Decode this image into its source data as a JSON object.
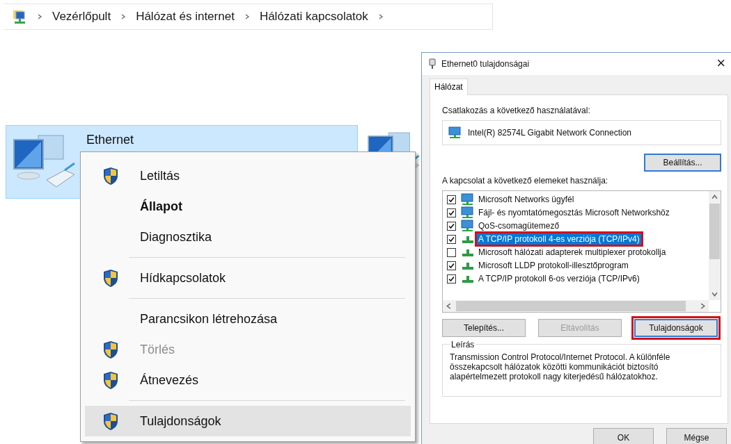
{
  "breadcrumb": {
    "items": [
      "Vezérlőpult",
      "Hálózat és internet",
      "Hálózati kapcsolatok"
    ]
  },
  "connections": [
    {
      "label": "Ethernet",
      "selected": true
    }
  ],
  "context_menu": {
    "items": [
      {
        "kind": "item",
        "label": "Letiltás",
        "shield": true,
        "bold": false,
        "disabled": false,
        "selected": false
      },
      {
        "kind": "item",
        "label": "Állapot",
        "shield": false,
        "bold": true,
        "disabled": false,
        "selected": false
      },
      {
        "kind": "item",
        "label": "Diagnosztika",
        "shield": false,
        "bold": false,
        "disabled": false,
        "selected": false
      },
      {
        "kind": "separator"
      },
      {
        "kind": "item",
        "label": "Hídkapcsolatok",
        "shield": true,
        "bold": false,
        "disabled": false,
        "selected": false
      },
      {
        "kind": "separator"
      },
      {
        "kind": "item",
        "label": "Parancsikon létrehozása",
        "shield": false,
        "bold": false,
        "disabled": false,
        "selected": false
      },
      {
        "kind": "item",
        "label": "Törlés",
        "shield": true,
        "bold": false,
        "disabled": true,
        "selected": false
      },
      {
        "kind": "item",
        "label": "Átnevezés",
        "shield": true,
        "bold": false,
        "disabled": false,
        "selected": false
      },
      {
        "kind": "separator"
      },
      {
        "kind": "item",
        "label": "Tulajdonságok",
        "shield": true,
        "bold": false,
        "disabled": false,
        "selected": true
      }
    ]
  },
  "dialog": {
    "title": "Ethernet0 tulajdonságai",
    "close": "×",
    "tabs": [
      {
        "label": "Hálózat",
        "selected": true
      }
    ],
    "connect_label": "Csatlakozás a következő használatával:",
    "adapter": "Intel(R) 82574L Gigabit Network Connection",
    "configure_button": "Beállítás...",
    "items_label": "A kapcsolat a következő elemeket használja:",
    "components": [
      {
        "kind": "client",
        "label": "Microsoft Networks ügyfél",
        "checked": true,
        "selected": false,
        "outlined": false
      },
      {
        "kind": "client",
        "label": "Fájl- és nyomtatómegosztás Microsoft Networkshöz",
        "checked": true,
        "selected": false,
        "outlined": false
      },
      {
        "kind": "client",
        "label": "QoS-csomagütemező",
        "checked": true,
        "selected": false,
        "outlined": false
      },
      {
        "kind": "protocol",
        "label": "A TCP/IP protokoll 4-es verziója (TCP/IPv4)",
        "checked": true,
        "selected": true,
        "outlined": true
      },
      {
        "kind": "protocol",
        "label": "Microsoft hálózati adapterek multiplexer protokollja",
        "checked": false,
        "selected": false,
        "outlined": false
      },
      {
        "kind": "protocol",
        "label": "Microsoft LLDP protokoll-illesztőprogram",
        "checked": true,
        "selected": false,
        "outlined": false
      },
      {
        "kind": "protocol",
        "label": "A TCP/IP protokoll 6-os verziója (TCP/IPv6)",
        "checked": true,
        "selected": false,
        "outlined": false
      }
    ],
    "buttons": [
      {
        "label": "Telepítés...",
        "disabled": false,
        "outlined": false
      },
      {
        "label": "Eltávolítás",
        "disabled": true,
        "outlined": false
      },
      {
        "label": "Tulajdonságok",
        "disabled": false,
        "outlined": true
      }
    ],
    "description": {
      "title": "Leírás",
      "text": "Transmission Control Protocol/Internet Protocol. A különféle összekapcsolt hálózatok közötti kommunikációt biztosító alapértelmezett protokoll nagy kiterjedésű hálózatokhoz."
    },
    "footer_buttons": [
      "OK",
      "Mégse"
    ]
  }
}
